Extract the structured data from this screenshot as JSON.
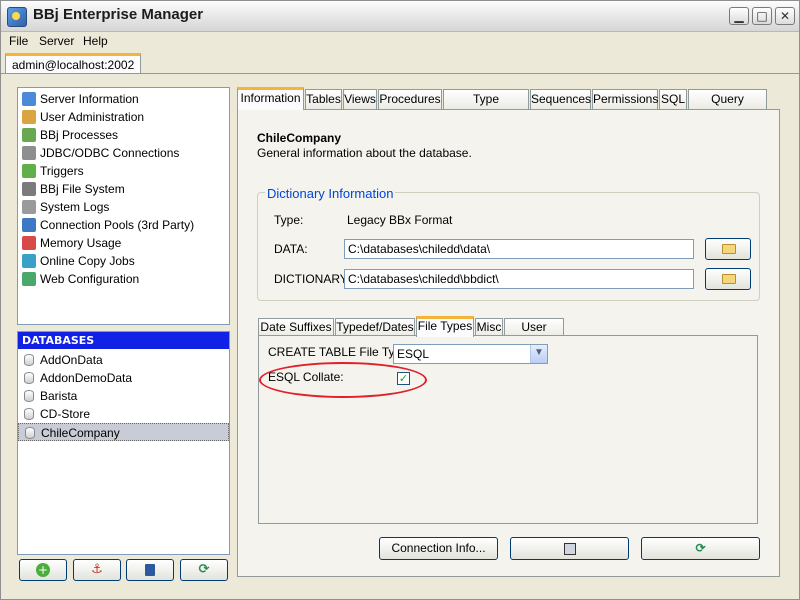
{
  "window": {
    "title": "BBj Enterprise Manager"
  },
  "menu": {
    "file": "File",
    "server": "Server",
    "help": "Help"
  },
  "connection_tab": "admin@localhost:2002",
  "nav": {
    "items": [
      {
        "label": "Server Information",
        "icon": "server-info-icon",
        "color": "#4a8ad8"
      },
      {
        "label": "User Administration",
        "icon": "users-icon",
        "color": "#d9a441"
      },
      {
        "label": "BBj Processes",
        "icon": "processes-icon",
        "color": "#6aa84f"
      },
      {
        "label": "JDBC/ODBC Connections",
        "icon": "connections-icon",
        "color": "#8e8e8e"
      },
      {
        "label": "Triggers",
        "icon": "triggers-icon",
        "color": "#5fb04a"
      },
      {
        "label": "BBj File System",
        "icon": "filesystem-icon",
        "color": "#7b7b7b"
      },
      {
        "label": "System Logs",
        "icon": "logs-icon",
        "color": "#9a9a9a"
      },
      {
        "label": "Connection Pools (3rd Party)",
        "icon": "pools-icon",
        "color": "#3d78c4"
      },
      {
        "label": "Memory Usage",
        "icon": "memory-icon",
        "color": "#d84a4a"
      },
      {
        "label": "Online Copy Jobs",
        "icon": "copy-jobs-icon",
        "color": "#3aa0c8"
      },
      {
        "label": "Web Configuration",
        "icon": "web-config-icon",
        "color": "#4aa86a"
      }
    ]
  },
  "databases": {
    "header": "DATABASES",
    "items": [
      "AddOnData",
      "AddonDemoData",
      "Barista",
      "CD-Store",
      "ChileCompany"
    ],
    "selected": "ChileCompany"
  },
  "db_buttons": {
    "add": "+",
    "anchor": "⚓",
    "delete": "🗑",
    "refresh": "⟳"
  },
  "tabs": [
    "Information",
    "Tables",
    "Views",
    "Procedures",
    "Type Definitions",
    "Sequences",
    "Permissions",
    "SQL",
    "Query Analysis"
  ],
  "active_tab": "Information",
  "info": {
    "title": "ChileCompany",
    "subtitle": "General information about the database.",
    "group_title": "Dictionary Information",
    "type_label": "Type:",
    "type_value": "Legacy BBx Format",
    "data_label": "DATA:",
    "data_value": "C:\\databases\\chiledd\\data\\",
    "dict_label": "DICTIONARY:",
    "dict_value": "C:\\databases\\chiledd\\bbdict\\"
  },
  "subtabs": [
    "Date Suffixes",
    "Typedef/Dates",
    "File Types",
    "Misc",
    "User Props"
  ],
  "active_subtab": "File Types",
  "file_types": {
    "create_table_label": "CREATE TABLE File Type:",
    "create_table_value": "ESQL",
    "esql_collate_label": "ESQL Collate:",
    "esql_collate_checked": true
  },
  "bottom_buttons": {
    "connection_info": "Connection Info...",
    "save": "💾",
    "refresh": "⟳"
  },
  "colors": {
    "accent_tab": "#f4b43b",
    "db_header": "#1221e6",
    "group_title": "#0046d5",
    "highlight_circle": "#e0202a"
  }
}
